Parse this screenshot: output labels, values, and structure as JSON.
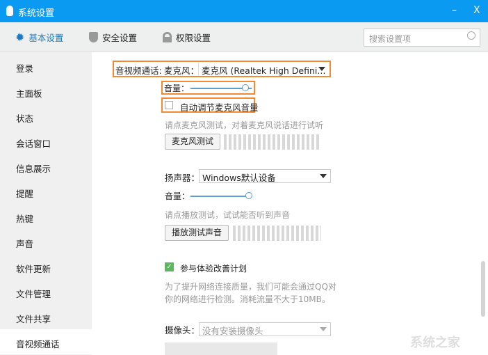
{
  "window": {
    "title": "系统设置",
    "minimize": "–",
    "close": "X"
  },
  "toolbar": {
    "tabs": [
      {
        "label": "基本设置",
        "icon": "gear-icon"
      },
      {
        "label": "安全设置",
        "icon": "shield-icon"
      },
      {
        "label": "权限设置",
        "icon": "lock-icon"
      }
    ],
    "search_placeholder": "搜索设置项"
  },
  "sidebar": {
    "items": [
      "登录",
      "主面板",
      "状态",
      "会话窗口",
      "信息展示",
      "提醒",
      "热键",
      "声音",
      "软件更新",
      "文件管理",
      "文件共享",
      "音视频通话"
    ],
    "active": "音视频通话"
  },
  "av": {
    "section_label": "音视频通话:",
    "mic_label": "麦克风：",
    "mic_value": "麦克风 (Realtek High Defini...",
    "mic_volume_label": "音量：",
    "mic_volume": 0.9,
    "auto_adjust_label": "自动调节麦克风音量",
    "auto_adjust_checked": false,
    "mic_hint": "请点麦克风测试，对着麦克风说话进行试听",
    "mic_test_button": "麦克风测试",
    "speaker_label": "扬声器：",
    "speaker_value": "Windows默认设备",
    "speaker_volume_label": "音量：",
    "speaker_volume": 1.0,
    "speaker_hint": "请点播放测试，试试能否听到声音",
    "speaker_test_button": "播放测试声音",
    "improve_label": "参与体验改善计划",
    "improve_checked": true,
    "improve_desc1": "为了提升网络连接质量，我们可能会通过QQ对",
    "improve_desc2": "你的网络进行检测。消耗流量不大于10MB。",
    "camera_label": "摄像头：",
    "camera_value": "没有安装摄像头"
  },
  "watermark": "系统之家",
  "colors": {
    "accent": "#0b9af2",
    "highlight": "#f08a35",
    "check": "#5cb85c"
  }
}
